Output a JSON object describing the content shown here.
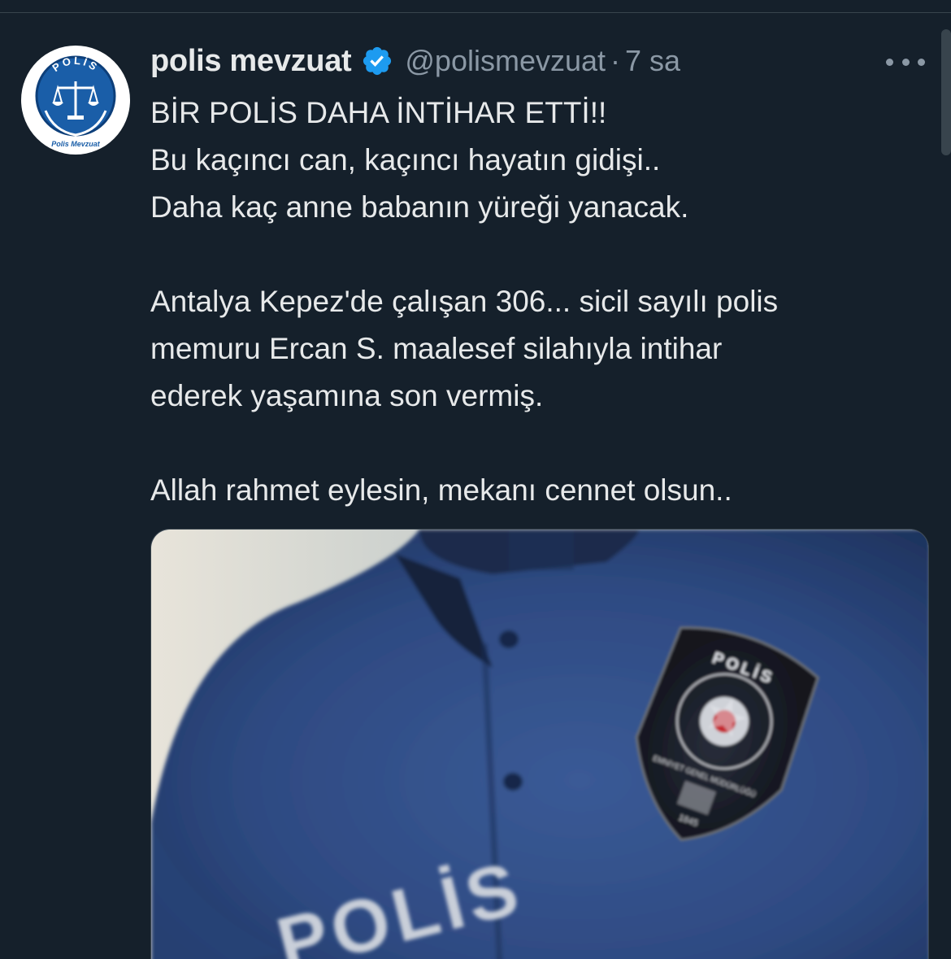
{
  "tweet": {
    "display_name": "polis mevzuat",
    "handle": "@polismevzuat",
    "separator": "·",
    "time": "7 sa",
    "lines": [
      "BİR POLİS DAHA İNTİHAR ETTİ!!",
      "Bu kaçıncı can, kaçıncı hayatın gidişi..",
      "Daha kaç anne babanın yüreği yanacak.",
      "",
      "Antalya Kepez'de çalışan 306... sicil sayılı polis",
      "memuru Ercan S. maalesef silahıyla intihar",
      "ederek yaşamına son vermiş.",
      "",
      "Allah rahmet eylesin, mekanı cennet olsun.."
    ]
  },
  "avatar": {
    "logo_text": "POLİS",
    "logo_subtext": "Polis Mevzuat"
  },
  "media": {
    "shirt_text": "POLİS",
    "badge_text": "POLİS",
    "badge_ring_text": "EMNİYET GENEL MÜDÜRLÜĞÜ",
    "badge_year": "1845"
  },
  "icons": {
    "verified": "verified-badge-icon",
    "more": "more-options-icon"
  },
  "colors": {
    "background": "#15202b",
    "primary_text": "#e7e9ea",
    "secondary_text": "#8b98a5",
    "verified_blue": "#1d9bf0"
  }
}
